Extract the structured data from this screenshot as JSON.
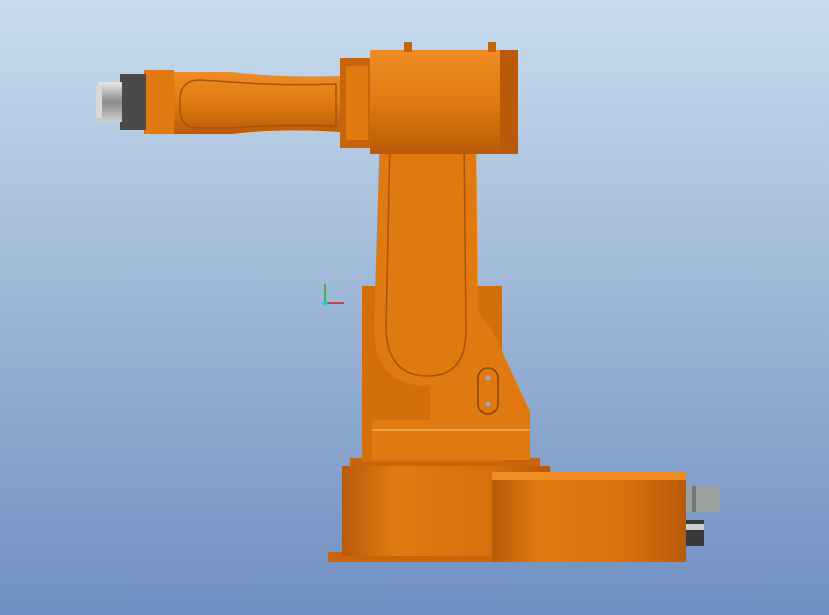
{
  "viewport": {
    "background_top": "#c9dcee",
    "background_bottom": "#6f8fc2"
  },
  "model": {
    "body_color": "#e07a10",
    "shadow_color": "#b95a08",
    "highlight_color": "#f08c24",
    "tool_metal_color": "#a9a9a9",
    "tool_dark_color": "#4a4a4a"
  },
  "triad": {
    "x_axis_color": "#d02020",
    "y_axis_color": "#20b020",
    "origin_color": "#20c8e8"
  }
}
